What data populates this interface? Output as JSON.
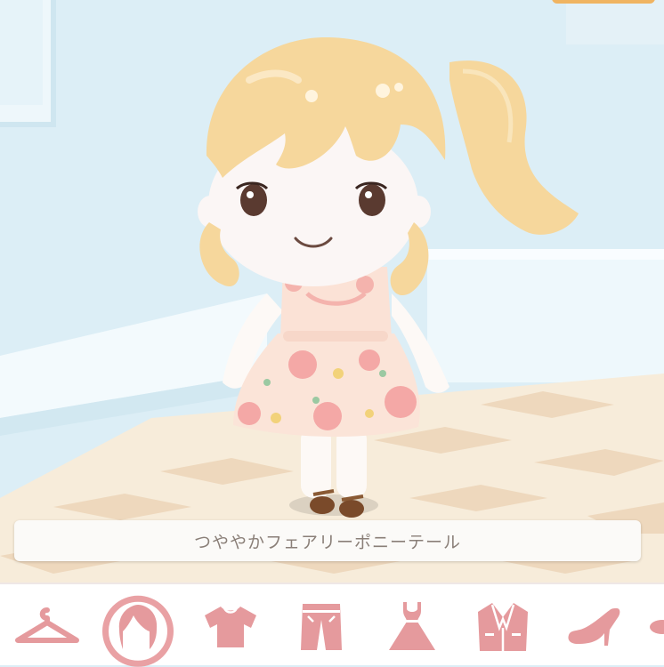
{
  "item_name": "つややかフェアリーポニーテール",
  "colors": {
    "accent": "#e9a1a4",
    "icon": "#e59a9d",
    "wall": "#dceef6",
    "floor_light": "#f8eddb",
    "floor_tile": "#ead7bf",
    "hair": "#f6d79c"
  },
  "tabs": [
    {
      "id": "hanger",
      "icon": "hanger-icon",
      "active": false
    },
    {
      "id": "hair",
      "icon": "hair-icon",
      "active": true
    },
    {
      "id": "tops",
      "icon": "shirt-icon",
      "active": false
    },
    {
      "id": "bottoms",
      "icon": "pants-icon",
      "active": false
    },
    {
      "id": "dress",
      "icon": "dress-icon",
      "active": false
    },
    {
      "id": "outer",
      "icon": "jacket-icon",
      "active": false
    },
    {
      "id": "shoes",
      "icon": "heel-shoe-icon",
      "active": false
    },
    {
      "id": "accessory",
      "icon": "accessory-icon",
      "active": false
    }
  ]
}
